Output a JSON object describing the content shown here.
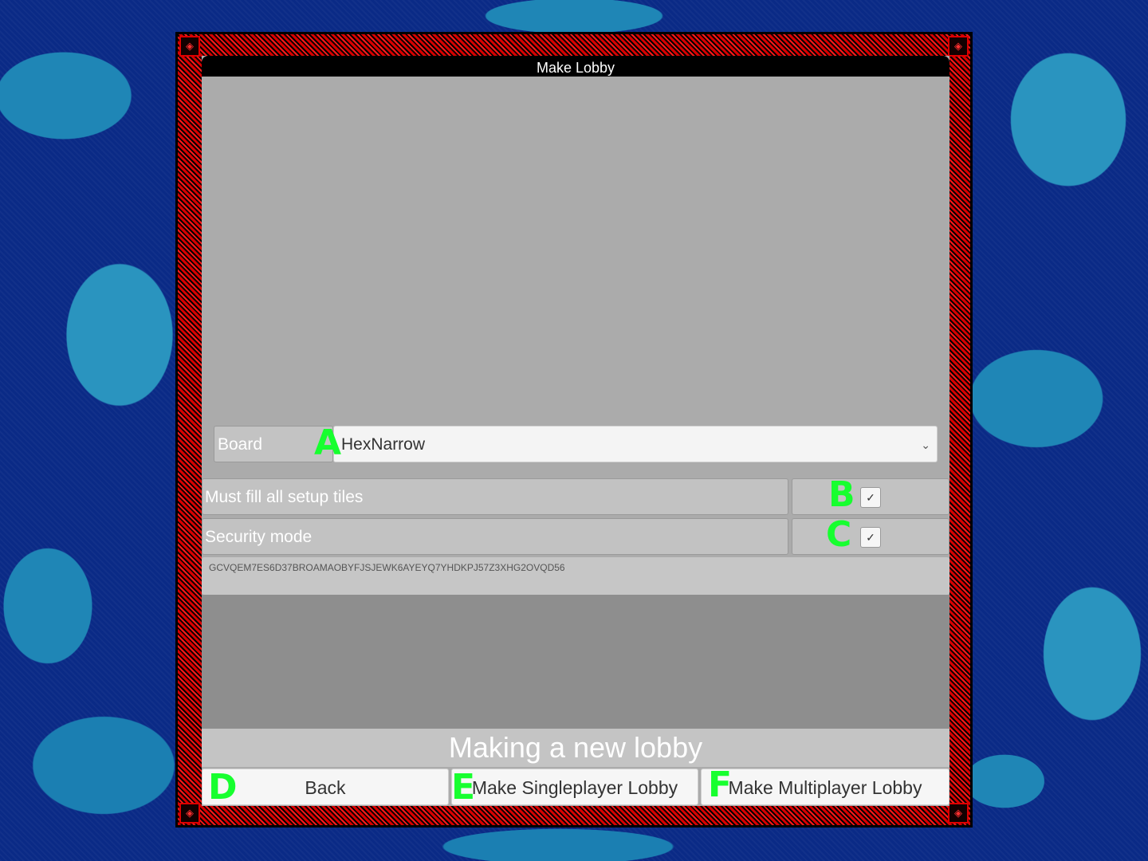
{
  "window": {
    "title": "Make Lobby"
  },
  "board": {
    "label": "Board",
    "selected": "HexNarrow",
    "chevron": "⌄"
  },
  "options": [
    {
      "label": "Must fill all setup tiles",
      "checked": true,
      "mark": "✓"
    },
    {
      "label": "Security mode",
      "checked": true,
      "mark": "✓"
    }
  ],
  "key": "GCVQEM7ES6D37BROAMAOBYFJSJEWK6AYEYQ7YHDKPJ57Z3XHG2OVQD56",
  "status": "Making a new lobby",
  "buttons": {
    "back": "Back",
    "singleplayer": "Make Singleplayer Lobby",
    "multiplayer": "Make Multiplayer Lobby"
  },
  "markers": [
    "A",
    "B",
    "C",
    "D",
    "E",
    "F"
  ],
  "colors": {
    "frame": "#d80000",
    "panel": "#ababab",
    "marker": "#17ff2f",
    "background": "#0a2a86"
  }
}
